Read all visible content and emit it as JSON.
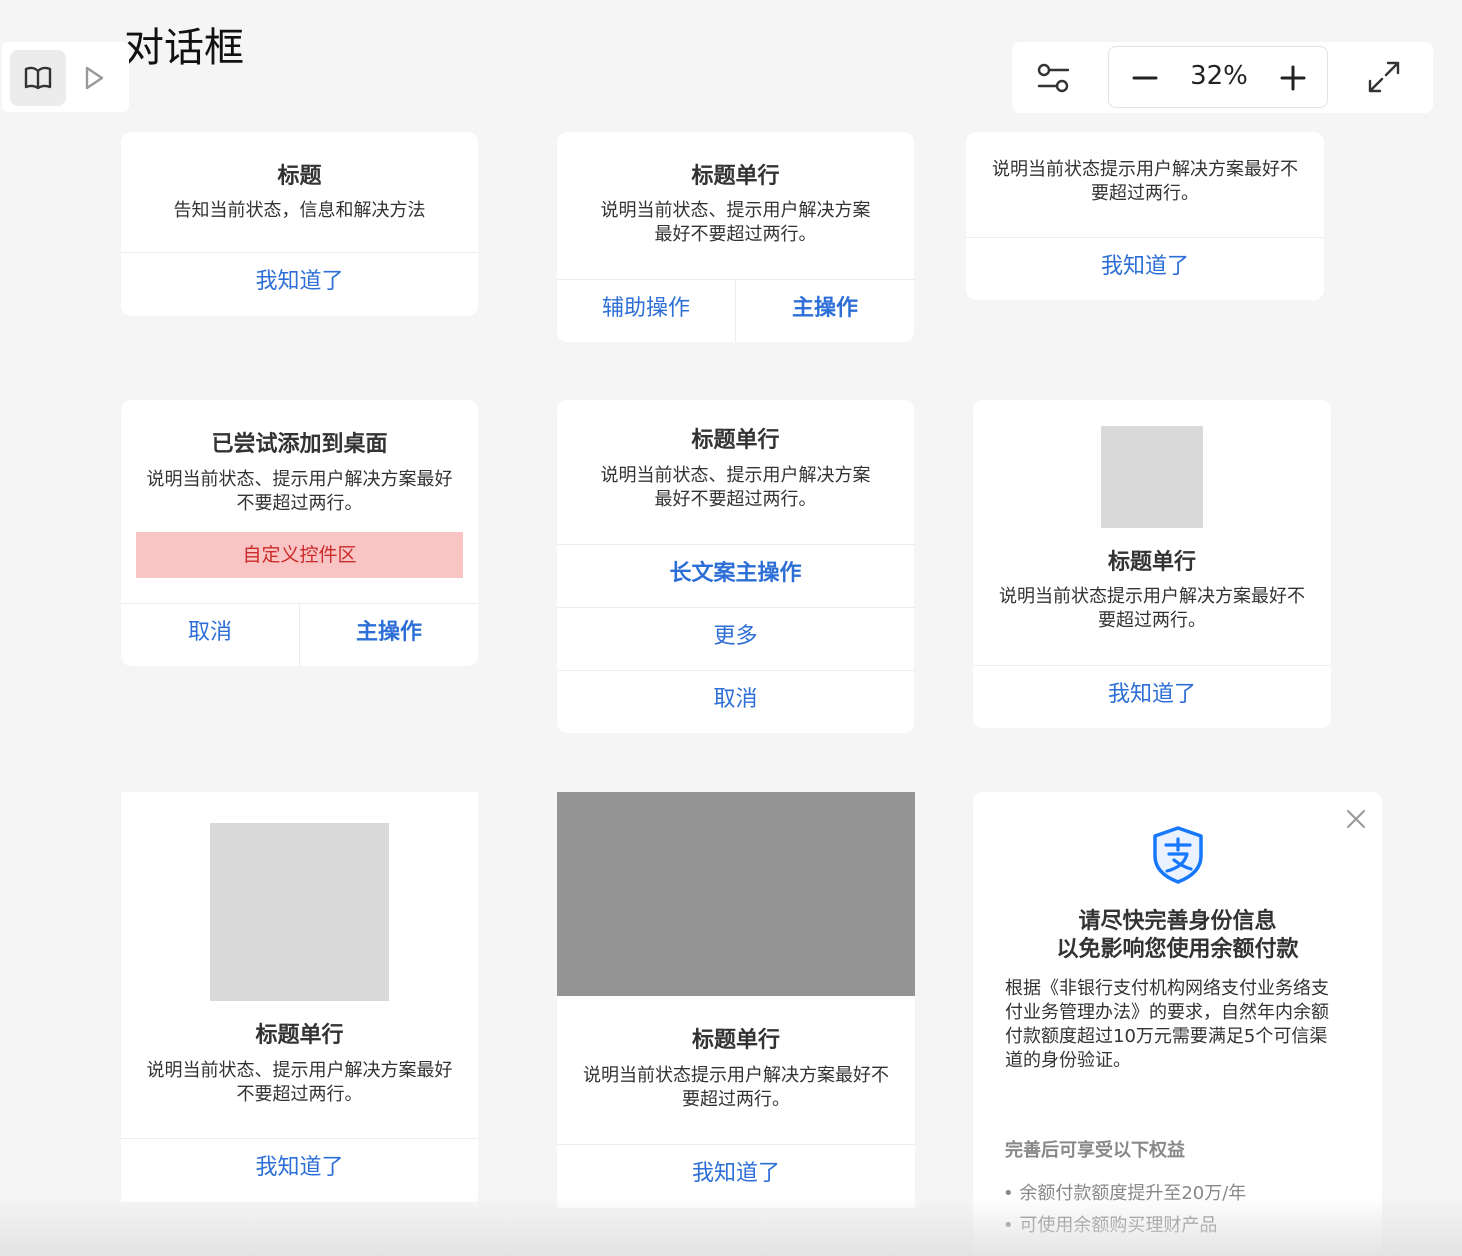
{
  "page": {
    "title": "对话框"
  },
  "toolbar": {
    "zoom_value": "32%",
    "icons": [
      "book-icon",
      "play-icon",
      "filter-settings-icon",
      "minus-icon",
      "plus-icon",
      "expand-icon"
    ]
  },
  "dialogs": {
    "d1": {
      "title": "标题",
      "desc": "告知当前状态，信息和解决方法",
      "button": "我知道了"
    },
    "d2": {
      "title": "标题单行",
      "desc_line1": "说明当前状态、提示用户解决方案",
      "desc_line2": "最好不要超过两行。",
      "secondary": "辅助操作",
      "primary": "主操作"
    },
    "d3": {
      "desc_line1": "说明当前状态提示用户解决方案最好不",
      "desc_line2": "要超过两行。",
      "button": "我知道了"
    },
    "d4": {
      "title": "已尝试添加到桌面",
      "desc_line1": "说明当前状态、提示用户解决方案最好",
      "desc_line2": "不要超过两行。",
      "custom_area": "自定义控件区",
      "cancel": "取消",
      "primary": "主操作"
    },
    "d5": {
      "title": "标题单行",
      "desc_line1": "说明当前状态、提示用户解决方案",
      "desc_line2": "最好不要超过两行。",
      "long_primary": "长文案主操作",
      "more": "更多",
      "cancel": "取消"
    },
    "d6": {
      "title": "标题单行",
      "desc_line1": "说明当前状态提示用户解决方案最好不",
      "desc_line2": "要超过两行。",
      "button": "我知道了"
    },
    "d7": {
      "title": "标题单行",
      "desc_line1": "说明当前状态、提示用户解决方案最好",
      "desc_line2": "不要超过两行。",
      "button": "我知道了"
    },
    "d8": {
      "title": "标题单行",
      "desc_line1": "说明当前状态提示用户解决方案最好不",
      "desc_line2": "要超过两行。",
      "button": "我知道了"
    },
    "d9": {
      "icon": "alipay-shield-icon",
      "title_line1": "请尽快完善身份信息",
      "title_line2": "以免影响您使用余额付款",
      "body_lines": [
        "根据《非银行支付机构网络支付业务络支",
        "付业务管理办法》的要求，自然年内余额",
        "付款额度超过10万元需要满足5个可信渠",
        "道的身份验证。"
      ],
      "benefits_title": "完善后可享受以下权益",
      "benefits": [
        "余额付款额度提升至20万/年",
        "可使用余额购买理财产品"
      ]
    }
  },
  "colors": {
    "link_blue": "#2d6fd6",
    "custom_area_bg": "#f8c4c4",
    "custom_area_text": "#cc2a2a",
    "alipay_blue": "#1677ff"
  }
}
